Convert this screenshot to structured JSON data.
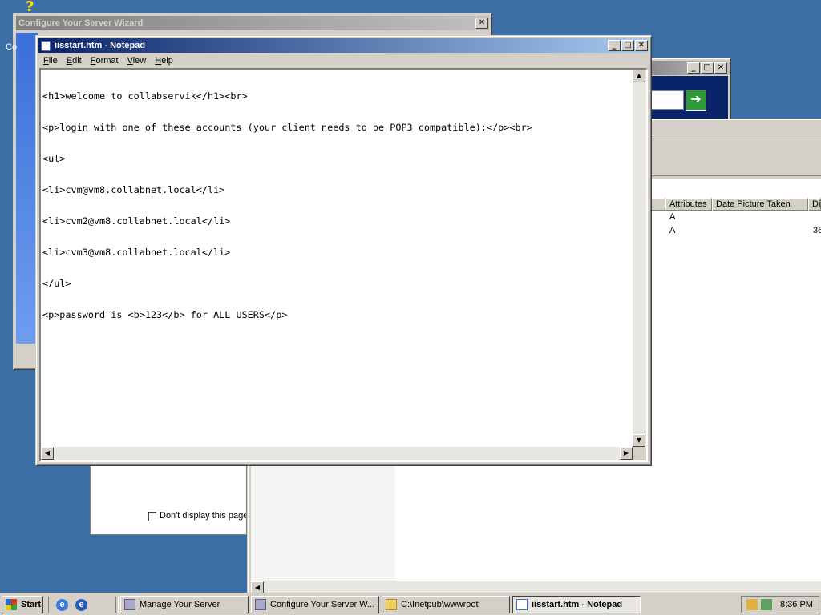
{
  "wizard": {
    "title": "Configure Your Server Wizard",
    "left_fragment": "Co",
    "checkbox_label": "Don't display this page"
  },
  "background_window": {
    "columns": [
      "Attributes",
      "Date Picture Taken",
      "Di"
    ],
    "rows": [
      {
        "attributes": "A",
        "extra": ""
      },
      {
        "attributes": "A",
        "extra": "36"
      }
    ]
  },
  "notepad": {
    "title": "iisstart.htm - Notepad",
    "menu": [
      "File",
      "Edit",
      "Format",
      "View",
      "Help"
    ],
    "lines": [
      "<h1>welcome to collabservik</h1><br>",
      "<p>login with one of these accounts (your client needs to be POP3 compatible):</p><br>",
      "<ul>",
      "<li>cvm@vm8.collabnet.local</li>",
      "<li>cvm2@vm8.collabnet.local</li>",
      "<li>cvm3@vm8.collabnet.local</li>",
      "</ul>",
      "<p>password is <b>123</b> for ALL USERS</p>"
    ]
  },
  "taskbar": {
    "start": "Start",
    "tasks": [
      {
        "label": "Manage Your Server",
        "active": false
      },
      {
        "label": "Configure Your Server W...",
        "active": false
      },
      {
        "label": "C:\\Inetpub\\wwwroot",
        "active": false
      },
      {
        "label": "iisstart.htm - Notepad",
        "active": true
      }
    ],
    "clock": "8:36 PM"
  },
  "icons": [
    "notepad-icon",
    "minimize-icon",
    "maximize-icon",
    "close-icon",
    "go-arrow-icon",
    "windows-logo-icon",
    "ie-icon",
    "folder-icon",
    "server-icon",
    "tray-icon"
  ],
  "colors": {
    "desktop": "#3a6ea5",
    "active_title": "#0a246a",
    "chrome": "#d4d0c8"
  }
}
